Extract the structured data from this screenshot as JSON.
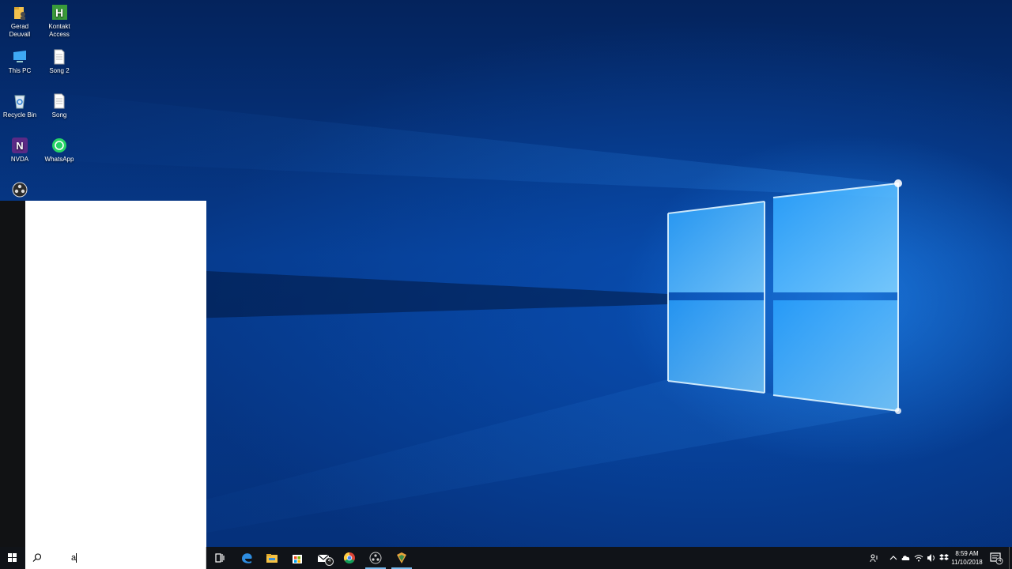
{
  "desktop": {
    "icons": [
      {
        "label": "Gerad\nDeuvall",
        "icon": "folder-user-icon"
      },
      {
        "label": "Kontakt\nAccess",
        "icon": "kontakt-access-icon"
      },
      {
        "label": "This PC",
        "icon": "this-pc-icon"
      },
      {
        "label": "Song 2",
        "icon": "document-icon"
      },
      {
        "label": "Recycle Bin",
        "icon": "recycle-bin-icon"
      },
      {
        "label": "Song",
        "icon": "document-icon"
      },
      {
        "label": "NVDA",
        "icon": "nvda-icon"
      },
      {
        "label": "WhatsApp",
        "icon": "whatsapp-icon"
      },
      {
        "label": "",
        "icon": "obs-icon"
      }
    ]
  },
  "taskbar": {
    "search": {
      "value": "a"
    },
    "apps": [
      "task-view-icon",
      "edge-icon",
      "file-explorer-icon",
      "store-icon",
      "mail-icon",
      "chrome-icon",
      "obs-icon",
      "app-icon"
    ],
    "mail_badge": "4",
    "tray": {
      "time": "8:59 AM",
      "date": "11/10/2018",
      "notification_count": "4"
    }
  },
  "colors": {
    "taskbar": "#101318",
    "accent": "#76b9ed",
    "wallpaper_blue": "#063b8e"
  }
}
